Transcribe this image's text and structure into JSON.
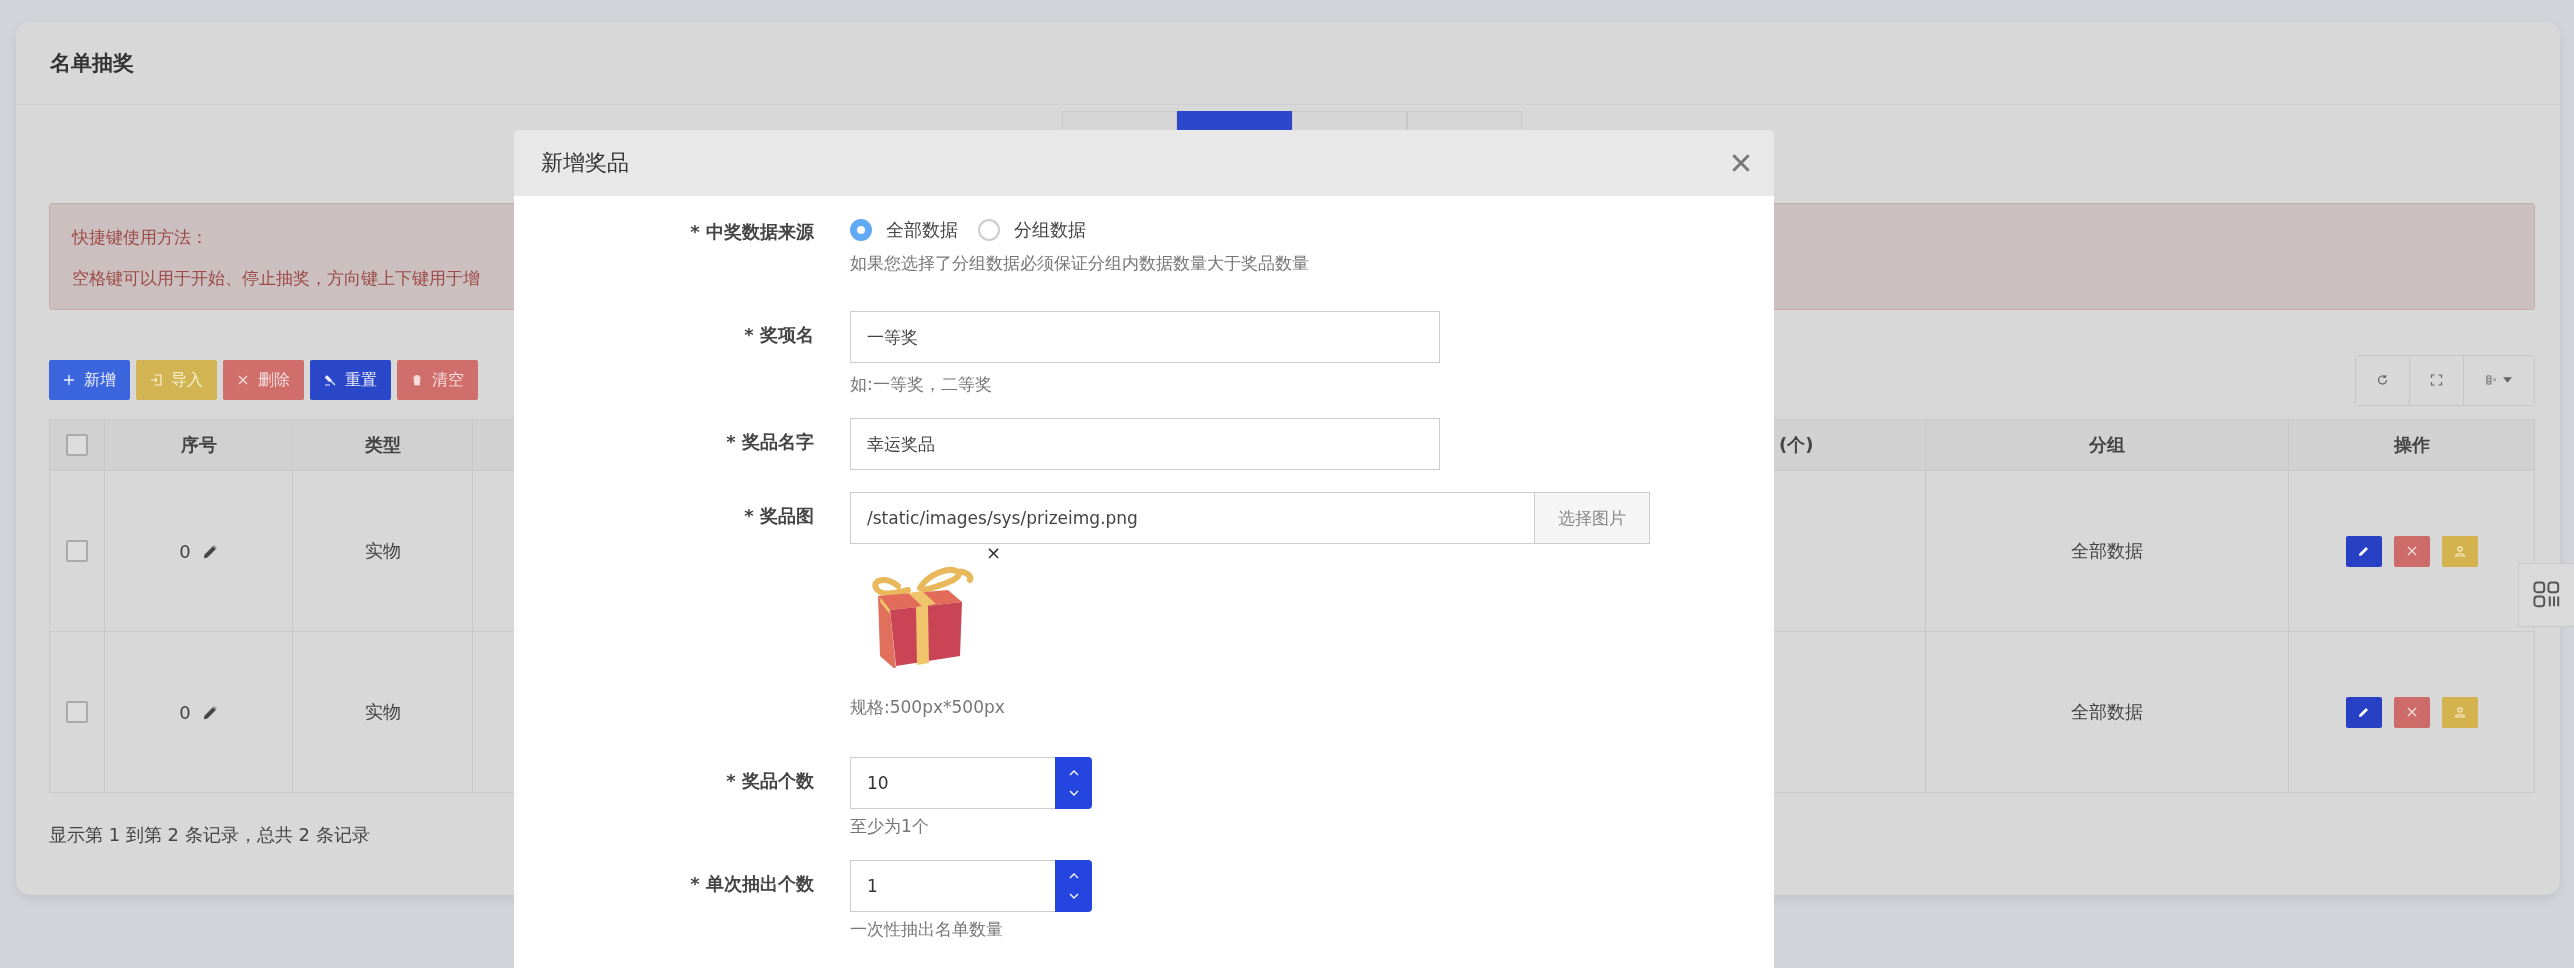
{
  "page": {
    "title": "名单抽奖"
  },
  "tabs": [
    {
      "selected": false
    },
    {
      "selected": true
    },
    {
      "selected": false
    },
    {
      "selected": false
    }
  ],
  "alert": {
    "title": "快捷键使用方法：",
    "text": "空格键可以用于开始、停止抽奖，方向键上下键用于增"
  },
  "toolbar": {
    "buttons": [
      {
        "kind": "add",
        "label": "新增"
      },
      {
        "kind": "import",
        "label": "导入"
      },
      {
        "kind": "delete",
        "label": "删除"
      },
      {
        "kind": "reset",
        "label": "重置"
      },
      {
        "kind": "clear",
        "label": "清空"
      }
    ]
  },
  "table": {
    "all_checked": false,
    "columns": [
      "序号",
      "类型",
      "(个)",
      "分组",
      "操作"
    ],
    "rows": [
      {
        "checked": false,
        "index": "0",
        "type": "实物",
        "group": "全部数据"
      },
      {
        "checked": false,
        "index": "0",
        "type": "实物",
        "group": "全部数据"
      }
    ]
  },
  "footer": "显示第 1 到第 2 条记录，总共 2 条记录",
  "modal": {
    "title": "新增奖品",
    "fields": [
      {
        "kind": "radio",
        "label": "* 中奖数据来源",
        "options": [
          {
            "label": "全部数据",
            "selected": true
          },
          {
            "label": "分组数据",
            "selected": false
          }
        ],
        "hint": "如果您选择了分组数据必须保证分组内数据数量大于奖品数量"
      },
      {
        "kind": "text",
        "label": "* 奖项名",
        "value": "一等奖",
        "hint": "如:一等奖，二等奖"
      },
      {
        "kind": "text",
        "label": "* 奖品名字",
        "value": "幸运奖品"
      },
      {
        "kind": "image",
        "label": "* 奖品图",
        "value": "/static/images/sys/prizeimg.png",
        "button": "选择图片",
        "remove": "×",
        "hint": "规格:500px*500px"
      },
      {
        "kind": "number",
        "label": "* 奖品个数",
        "value": "10",
        "hint": "至少为1个"
      },
      {
        "kind": "number",
        "label": "* 单次抽出个数",
        "value": "1",
        "hint": "一次性抽出名单数量"
      }
    ]
  }
}
